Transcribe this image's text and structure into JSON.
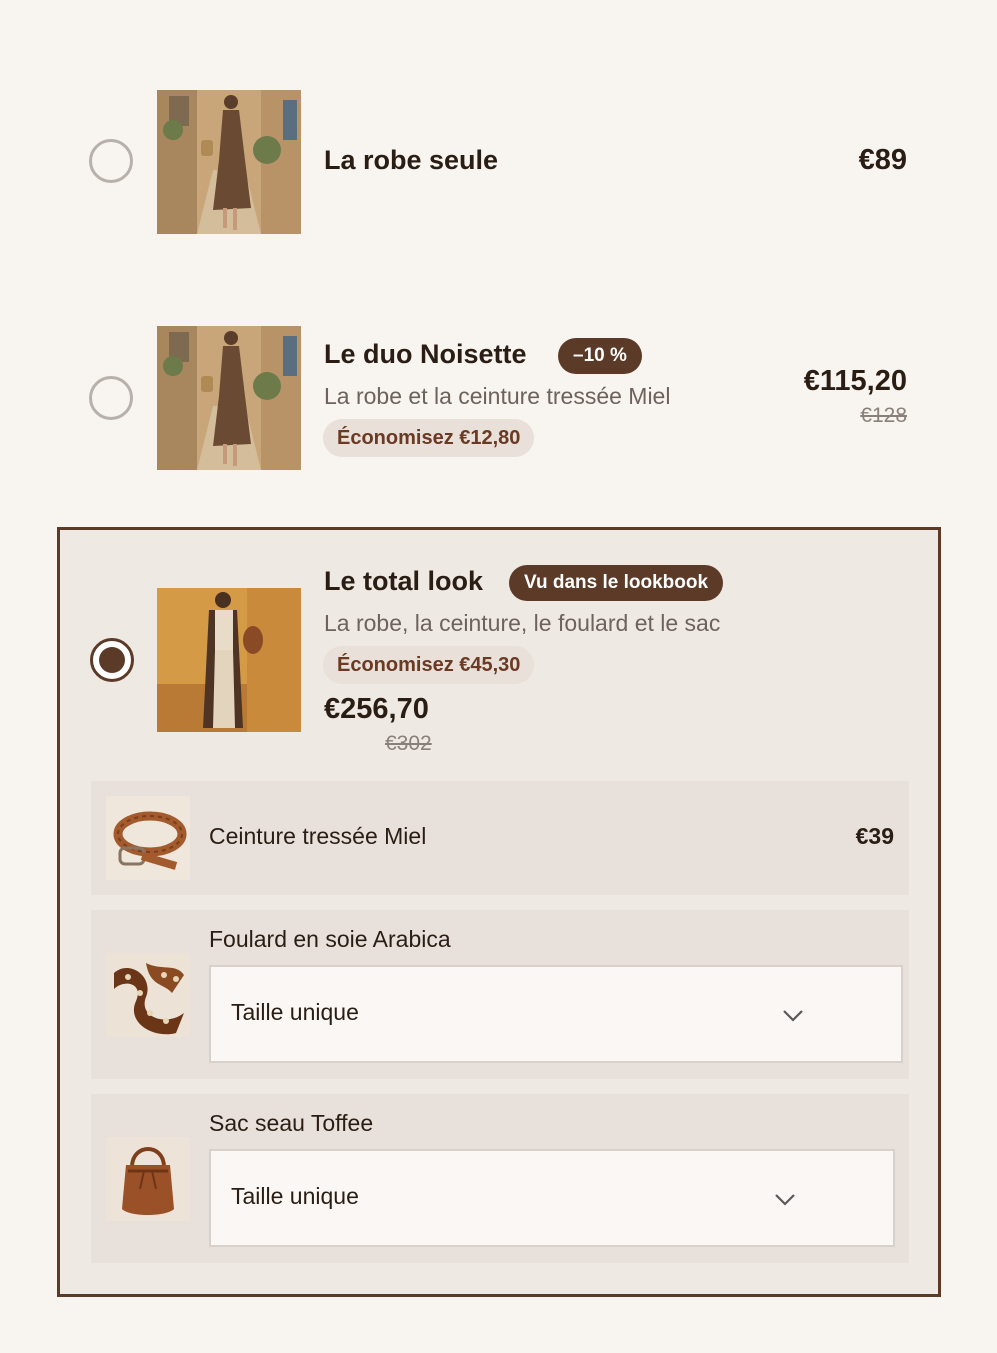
{
  "options": [
    {
      "title": "La robe seule",
      "price": "€89",
      "selected": false
    },
    {
      "title": "Le duo Noisette",
      "badge": "–10 %",
      "subtitle": "La robe et la ceinture tressée Miel",
      "savings": "Économisez €12,80",
      "price": "€115,20",
      "compare_price": "€128",
      "selected": false
    },
    {
      "title": "Le total look",
      "badge": "Vu dans le lookbook",
      "subtitle": "La robe, la ceinture, le foulard et le sac",
      "savings": "Économisez €45,30",
      "price": "€256,70",
      "compare_price": "€302",
      "selected": true,
      "items": [
        {
          "name": "Ceinture tressée Miel",
          "price": "€39",
          "icon": "braided-belt-image"
        },
        {
          "name": "Foulard en soie Arabica",
          "select_value": "Taille unique",
          "icon": "silk-scarf-image"
        },
        {
          "name": "Sac seau Toffee",
          "select_value": "Taille unique",
          "icon": "bucket-bag-image"
        }
      ]
    }
  ],
  "colors": {
    "accent": "#5c3a28",
    "background": "#f8f4f0",
    "selected_card_bg": "#efe9e3",
    "item_card_bg": "#e8e1db",
    "savings_text": "#6a3a23"
  }
}
